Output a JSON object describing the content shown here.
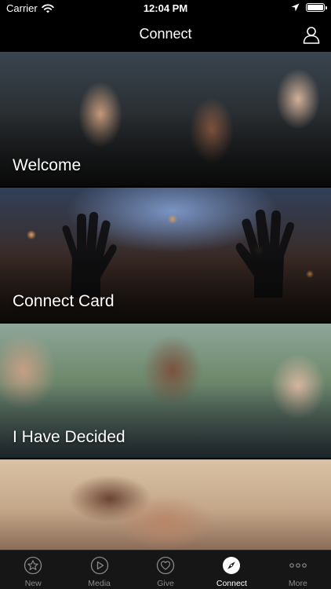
{
  "status_bar": {
    "carrier": "Carrier",
    "time": "12:04 PM",
    "icons": [
      "wifi-icon",
      "location-icon",
      "battery-icon"
    ]
  },
  "nav": {
    "title": "Connect",
    "right_icon": "profile-icon"
  },
  "cards": [
    {
      "label": "Welcome"
    },
    {
      "label": "Connect Card"
    },
    {
      "label": "I Have Decided"
    },
    {
      "label": ""
    }
  ],
  "tabs": [
    {
      "label": "New",
      "icon": "star-icon",
      "active": false
    },
    {
      "label": "Media",
      "icon": "play-icon",
      "active": false
    },
    {
      "label": "Give",
      "icon": "heart-icon",
      "active": false
    },
    {
      "label": "Connect",
      "icon": "compass-icon",
      "active": true
    },
    {
      "label": "More",
      "icon": "more-icon",
      "active": false
    }
  ],
  "colors": {
    "background": "#000000",
    "tab_bar": "#161616",
    "tab_inactive": "#8a8a8a",
    "tab_active": "#ffffff"
  }
}
